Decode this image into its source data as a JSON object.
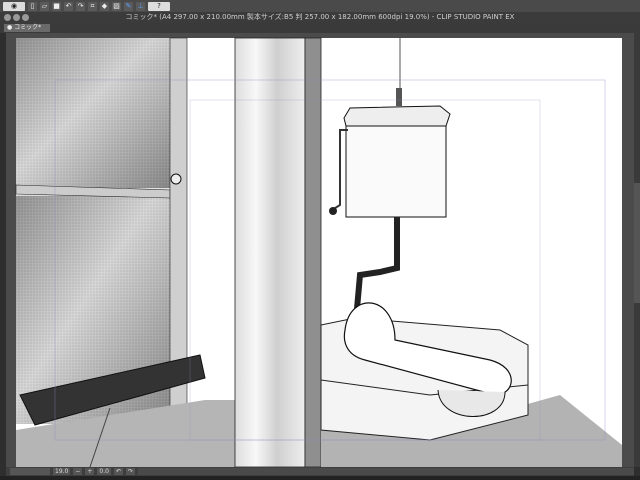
{
  "toolbar": {
    "items": [
      "eye-icon",
      "new-icon",
      "open-icon",
      "save-icon",
      "undo-icon",
      "redo-icon",
      "transform-icon",
      "fill-icon",
      "help-icon"
    ],
    "help_label": "?"
  },
  "window": {
    "title": "コミック* (A4 297.00 x 210.00mm 製本サイズ:B5 判 257.00 x 182.00mm 600dpi 19.0%) - CLIP STUDIO PAINT EX"
  },
  "tabs": [
    {
      "label": "コミック*"
    }
  ],
  "status": {
    "zoom": "19.0",
    "angle": "0.0"
  },
  "colors": {
    "background": "#2e2e2e",
    "accent": "#5aa0ff"
  }
}
